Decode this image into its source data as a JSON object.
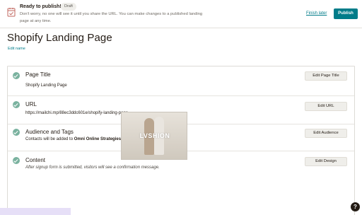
{
  "publish_bar": {
    "title": "Ready to publish!",
    "badge": "Draft",
    "message": "Don't worry, no one will see it until you share the URL. You can make changes to a published landing page at any time.",
    "finish_later": "Finish later",
    "publish": "Publish"
  },
  "page": {
    "title": "Shopify Landing Page",
    "edit_name": "Edit name"
  },
  "checklist": [
    {
      "title": "Page Title",
      "subtitle": "Shopify Landing Page",
      "button": "Edit Page Title"
    },
    {
      "title": "URL",
      "subtitle": "https://mailchi.mp/88ec3ddc601e/shopify-landing-page",
      "button": "Edit URL"
    },
    {
      "title": "Audience and Tags",
      "subtitle_prefix": "Contacts will be added to ",
      "subtitle_bold": "Omni Online Strategies",
      "button": "Edit Audience"
    },
    {
      "title": "Content",
      "subtitle": "After signup form is submitted, visitors will see a confirmation message.",
      "button": "Edit Design"
    }
  ],
  "preview": {
    "logo_text": "LVSHION"
  },
  "help": {
    "label": "?"
  },
  "colors": {
    "accent": "#007c89",
    "check": "#7ab29f",
    "text": "#241c15"
  },
  "icons": {
    "publish_icon": "calendar-check-icon",
    "check_icon": "check-circle-icon",
    "help_icon": "help-icon"
  }
}
